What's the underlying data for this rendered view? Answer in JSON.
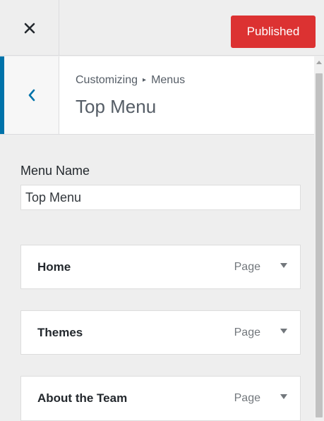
{
  "header": {
    "close_label": "close",
    "publish_label": "Published",
    "publish_color": "#dc3232"
  },
  "section": {
    "breadcrumb_root": "Customizing",
    "breadcrumb_separator": "▸",
    "breadcrumb_current": "Menus",
    "title": "Top Menu",
    "accent_color": "#0073aa"
  },
  "menu_name": {
    "label": "Menu Name",
    "value": "Top Menu"
  },
  "menu_items": [
    {
      "title": "Home",
      "type": "Page"
    },
    {
      "title": "Themes",
      "type": "Page"
    },
    {
      "title": "About the Team",
      "type": "Page"
    }
  ],
  "icons": {
    "close": "close-icon",
    "back": "chevron-left-icon",
    "toggle": "caret-down-icon"
  }
}
